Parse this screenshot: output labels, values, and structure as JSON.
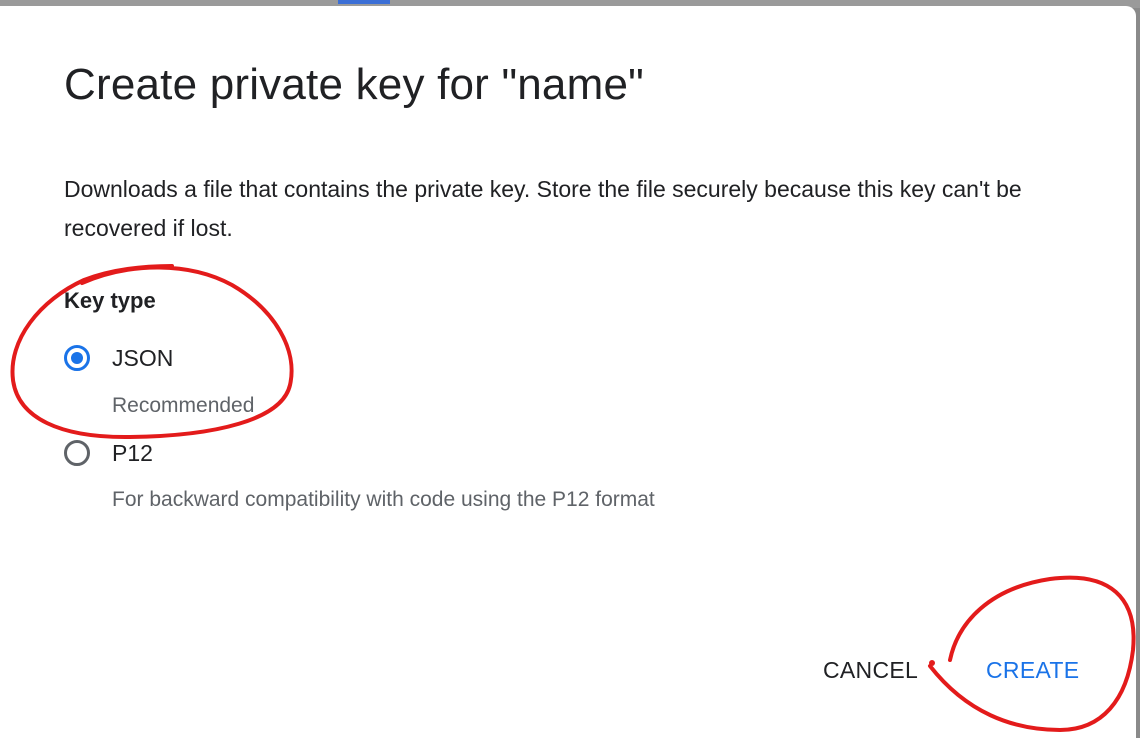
{
  "dialog": {
    "title": "Create private key for \"name\"",
    "description": "Downloads a file that contains the private key. Store the file securely because this key can't be recovered if lost.",
    "key_type_label": "Key type",
    "options": [
      {
        "label": "JSON",
        "help": "Recommended",
        "checked": true
      },
      {
        "label": "P12",
        "help": "For backward compatibility with code using the P12 format",
        "checked": false
      }
    ],
    "actions": {
      "cancel_label": "CANCEL",
      "create_label": "CREATE"
    }
  },
  "colors": {
    "accent": "#1a73e8",
    "annotation": "#e31b1b"
  }
}
